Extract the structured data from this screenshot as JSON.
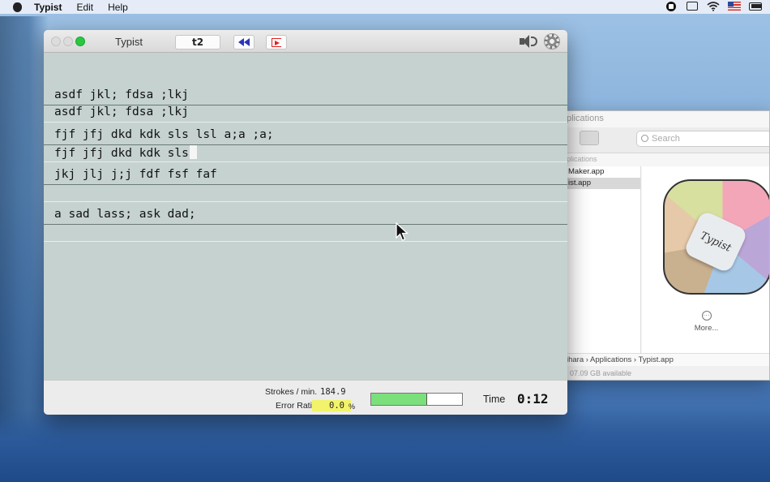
{
  "menubar": {
    "app_name": "Typist",
    "items": [
      "Edit",
      "Help"
    ]
  },
  "finder": {
    "title": "plications",
    "search_placeholder": "Search",
    "column_header": "plications",
    "rows": [
      "Maker.app",
      "ist.app"
    ],
    "selected_row": 1,
    "preview_label": "Typist",
    "more_label": "More...",
    "path": [
      "ihara",
      "Applications",
      "Typist.app"
    ],
    "status": "07.09 GB available"
  },
  "typist": {
    "title": "Typist",
    "lesson_button": "t2",
    "lines": [
      "asdf jkl; fdsa ;lkj",
      "asdf jkl; fdsa ;lkj",
      "fjf jfj dkd kdk sls lsl a;a ;a;",
      "fjf jfj dkd kdk sls",
      "jkj jlj j;j fdf fsf faf",
      "",
      "a sad lass; ask dad;",
      ""
    ],
    "status": {
      "strokes_label": "Strokes / min.",
      "strokes_value": "184.9",
      "error_label": "Error Ratio",
      "error_value": "0.0",
      "error_unit": "%",
      "progress_fraction": 0.62,
      "time_label": "Time",
      "time_value": "0:12"
    }
  },
  "colors": {
    "window_bg": "#c5d2cf",
    "progress_fill": "#7be07b",
    "error_highlight": "#f3f36b",
    "rewind_icon": "#2b35b8",
    "exit_icon": "#dd2222"
  },
  "icons": [
    "apple-icon",
    "record-icon",
    "airplay-icon",
    "wifi-icon",
    "us-flag-icon",
    "battery-icon",
    "rewind-icon",
    "exit-icon",
    "speaker-icon",
    "gear-icon",
    "search-icon",
    "more-icon",
    "mouse-pointer-icon"
  ]
}
